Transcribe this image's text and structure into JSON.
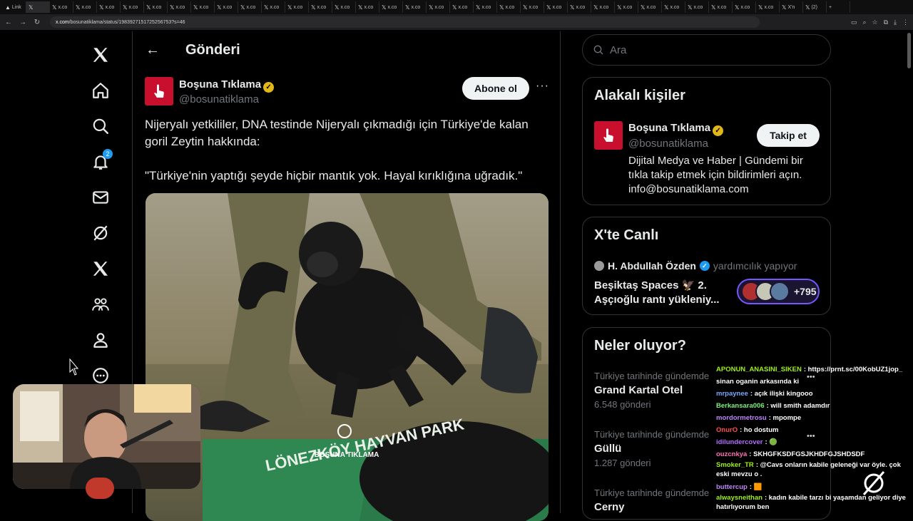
{
  "browser": {
    "tabs": [
      {
        "label": "Link",
        "fav": "▲"
      },
      {
        "label": "",
        "fav": "𝕏"
      },
      {
        "label": "x.co",
        "fav": "𝕏"
      },
      {
        "label": "x.co",
        "fav": "𝕏"
      },
      {
        "label": "x.co",
        "fav": "𝕏"
      },
      {
        "label": "x.co",
        "fav": "𝕏"
      },
      {
        "label": "x.co",
        "fav": "𝕏"
      },
      {
        "label": "x.co",
        "fav": "𝕏"
      },
      {
        "label": "x.co",
        "fav": "𝕏"
      },
      {
        "label": "x.co",
        "fav": "𝕏"
      },
      {
        "label": "x.co",
        "fav": "𝕏"
      },
      {
        "label": "x.co",
        "fav": "𝕏"
      },
      {
        "label": "x.co",
        "fav": "𝕏"
      },
      {
        "label": "x.co",
        "fav": "𝕏"
      },
      {
        "label": "x.co",
        "fav": "𝕏"
      },
      {
        "label": "x.co",
        "fav": "𝕏"
      },
      {
        "label": "x.co",
        "fav": "𝕏"
      },
      {
        "label": "x.co",
        "fav": "𝕏"
      },
      {
        "label": "x.co",
        "fav": "𝕏"
      },
      {
        "label": "x.co",
        "fav": "𝕏"
      },
      {
        "label": "x.co",
        "fav": "𝕏"
      },
      {
        "label": "x.co",
        "fav": "𝕏"
      },
      {
        "label": "x.co",
        "fav": "𝕏"
      },
      {
        "label": "x.co",
        "fav": "𝕏"
      },
      {
        "label": "x.co",
        "fav": "𝕏"
      },
      {
        "label": "x.co",
        "fav": "𝕏"
      },
      {
        "label": "x.co",
        "fav": "𝕏"
      },
      {
        "label": "x.co",
        "fav": "𝕏"
      },
      {
        "label": "x.co",
        "fav": "𝕏"
      },
      {
        "label": "x.co",
        "fav": "𝕏"
      },
      {
        "label": "x.co",
        "fav": "𝕏"
      },
      {
        "label": "x.co",
        "fav": "𝕏"
      },
      {
        "label": "x.co",
        "fav": "𝕏"
      },
      {
        "label": "X'n",
        "fav": "𝕏"
      },
      {
        "label": "(2)",
        "fav": "𝕏"
      }
    ],
    "url_domain": "x.com",
    "url_path": "/bosunatiklama/status/1983927151725256753?s=46"
  },
  "nav": {
    "notification_count": "2"
  },
  "header": {
    "title": "Gönderi"
  },
  "post": {
    "author_name": "Boşuna Tıklama",
    "author_handle": "@bosunatiklama",
    "subscribe_label": "Abone ol",
    "more": "···",
    "text": "Nijeryalı yetkililer, DNA testinde Nijeryalı çıkmadığı için Türkiye'de kalan goril Zeytin hakkında:",
    "quote": "\"Türkiye'nin yaptığı şeyde hiçbir mantık yok. Hayal kırıklığına uğradık.\"",
    "watermark": "BOŞUNA TIKLAMA",
    "shirt_text": "LÖNEZKÖY HAYVAN PARK"
  },
  "search": {
    "placeholder": "Ara"
  },
  "relevant": {
    "title": "Alakalı kişiler",
    "name": "Boşuna Tıklama",
    "handle": "@bosunatiklama",
    "follow_label": "Takip et",
    "bio": "Dijital Medya ve Haber | Gündemi bir tıkla takip etmek için bildirimleri açın. info@bosunatiklama.com"
  },
  "live": {
    "title": "X'te Canlı",
    "host": "H. Abdullah Özden",
    "role": "yardımcılık yapıyor",
    "space": "Beşiktaş Spaces 🦅 2. Aşçıoğlu rantı yükleniy...",
    "listeners": "+795"
  },
  "trends": {
    "title": "Neler oluyor?",
    "items": [
      {
        "context": "Türkiye tarihinde gündemde",
        "name": "Grand Kartal Otel",
        "count": "6.548 gönderi"
      },
      {
        "context": "Türkiye tarihinde gündemde",
        "name": "Güllü",
        "count": "1.287 gönderi"
      },
      {
        "context": "Türkiye tarihinde gündemde",
        "name": "Cerny",
        "count": ""
      }
    ]
  },
  "chat": {
    "messages": [
      {
        "user": "APONUN_ANASINI_SIKEN",
        "color": "#9ef01a",
        "text": ": https://prnt.sc/00KobUZ1jop_",
        "wrap": false
      },
      {
        "user": "",
        "color": "#ffffff",
        "text": "sinan oganin arkasında ki",
        "wrap": false
      },
      {
        "user": "mrpaynee",
        "color": "#7aa7ff",
        "text": ": açık ilişki kingooo",
        "wrap": false
      },
      {
        "user": "Berkansara006",
        "color": "#7af07a",
        "text": ": will smith adamdır",
        "wrap": false
      },
      {
        "user": "mordormetrosu",
        "color": "#c084fc",
        "text": ": mpompe",
        "wrap": false
      },
      {
        "user": "OnurO",
        "color": "#ff4d4d",
        "text": ": ho dostum",
        "wrap": false
      },
      {
        "user": "idilundercover",
        "color": "#b56bff",
        "text": ": 🟢",
        "wrap": false
      },
      {
        "user": "ouzcnkya",
        "color": "#ff6fb5",
        "text": ": SKHGFKSDFGSJKHDFGJSHDSDF",
        "wrap": false
      },
      {
        "user": "Smoker_TR",
        "color": "#9ef01a",
        "text": ": @Cavs onların kabile geleneği var öyle. çok eski mevzu o .",
        "wrap": true
      },
      {
        "user": "buttercup",
        "color": "#c084fc",
        "text": ": 🟧",
        "wrap": false
      },
      {
        "user": "alwaysneithan",
        "color": "#9ef01a",
        "text": ": kadın kabile tarzı bi yaşamdan geliyor diye hatırlıyorum ben",
        "wrap": true
      }
    ]
  },
  "colors": {
    "accent_blue": "#1d9bf0",
    "brand_red": "#c8102e",
    "verified_gold": "#e2b719",
    "live_purple": "#7856ff"
  }
}
